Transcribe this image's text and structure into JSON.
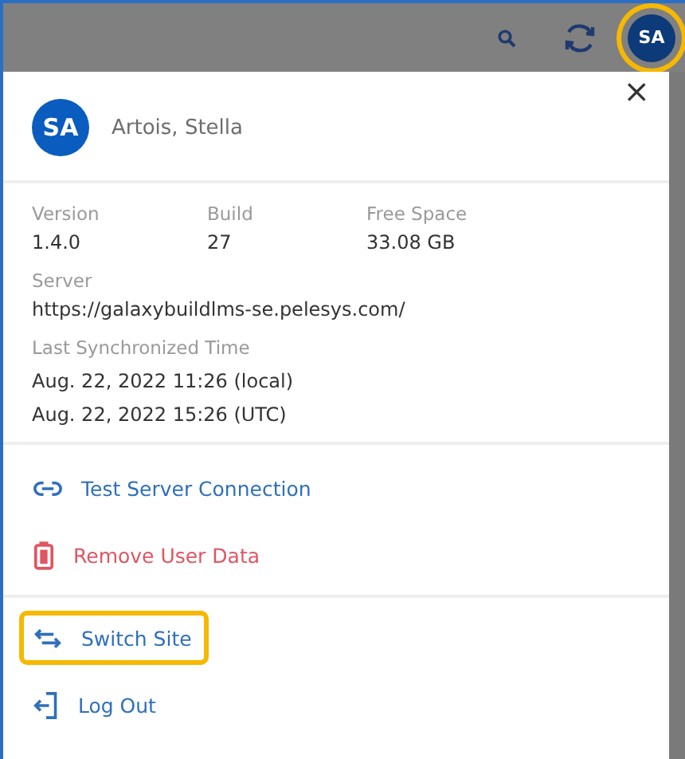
{
  "top_bar": {
    "avatar": {
      "initials": "SA",
      "highlighted": true
    }
  },
  "user": {
    "initials": "SA",
    "name": "Artois, Stella"
  },
  "close": {
    "glyph": "×"
  },
  "info": {
    "stats": [
      {
        "label": "Version",
        "value": "1.4.0"
      },
      {
        "label": "Build",
        "value": "27"
      },
      {
        "label": "Free Space",
        "value": "33.08 GB"
      }
    ],
    "server": {
      "label": "Server",
      "value": "https://galaxybuildlms-se.pelesys.com/"
    },
    "sync": {
      "label": "Last Synchronized Time",
      "values": [
        "Aug. 22, 2022 11:26 (local)",
        "Aug. 22, 2022 15:26 (UTC)"
      ]
    }
  },
  "action_groups": [
    [
      {
        "kind": "link",
        "label": "Test Server Connection",
        "danger": false,
        "highlighted": false
      },
      {
        "kind": "trash",
        "label": "Remove User Data",
        "danger": true,
        "highlighted": false
      }
    ],
    [
      {
        "kind": "swap",
        "label": "Switch Site",
        "danger": false,
        "highlighted": true
      },
      {
        "kind": "logout",
        "label": "Log Out",
        "danger": false,
        "highlighted": false
      }
    ]
  ]
}
